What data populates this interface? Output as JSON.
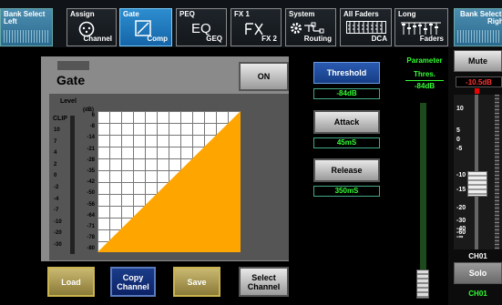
{
  "topbar": {
    "bank_left": {
      "label1": "Bank Select",
      "label2": "Left"
    },
    "bank_right": {
      "label1": "Bank Select",
      "label2": "Right"
    },
    "tabs": [
      {
        "top": "Assign",
        "bottom": "Channel",
        "icon": "dial-icon"
      },
      {
        "top": "Gate",
        "bottom": "Comp",
        "icon": "gate-curve-icon"
      },
      {
        "top": "PEQ",
        "bottom": "GEQ",
        "icon": "eq-icon",
        "icon_text": "EQ"
      },
      {
        "top": "FX 1",
        "bottom": "FX 2",
        "icon": "fx-icon"
      },
      {
        "top": "System",
        "bottom": "Routing",
        "icon": "gear-routing-icon"
      },
      {
        "top": "All Faders",
        "bottom": "DCA",
        "icon": "faders-grid-icon"
      },
      {
        "top": "Long",
        "bottom": "Faders",
        "icon": "long-faders-icon"
      }
    ]
  },
  "gate": {
    "title": "Gate",
    "on_label": "ON",
    "level_label": "Level",
    "db_label": "(dB)",
    "clip_label": "CLIP",
    "meter_ticks": [
      "10",
      "7",
      "4",
      "2",
      "0",
      "-2",
      "-4",
      "-7",
      "-10",
      "-20",
      "-30"
    ],
    "graph_ticks": [
      "6",
      "-8",
      "-14",
      "-21",
      "-28",
      "-35",
      "-42",
      "-50",
      "-56",
      "-64",
      "-71",
      "-78",
      "-80"
    ]
  },
  "params": {
    "threshold": {
      "label": "Threshold",
      "value": "-84dB"
    },
    "attack": {
      "label": "Attack",
      "value": "45mS"
    },
    "release": {
      "label": "Release",
      "value": "350mS"
    }
  },
  "parameter_panel": {
    "title": "Parameter",
    "name": "Thres.",
    "value": "-84dB"
  },
  "bottom_buttons": {
    "load": "Load",
    "copy": "Copy Channel",
    "save": "Save",
    "select": "Select Channel"
  },
  "channel_strip": {
    "mute": "Mute",
    "gain": "-10.5dB",
    "scale": [
      "10",
      "5",
      "0",
      "-5",
      "-10",
      "-15",
      "-20",
      "-30",
      "-40",
      "-60",
      "-∞"
    ],
    "name": "CH01",
    "solo": "Solo",
    "channel": "CH01"
  },
  "colors": {
    "accent_green": "#33ff33",
    "graph_orange": "#ffa500",
    "mute_red": "#e00000"
  }
}
